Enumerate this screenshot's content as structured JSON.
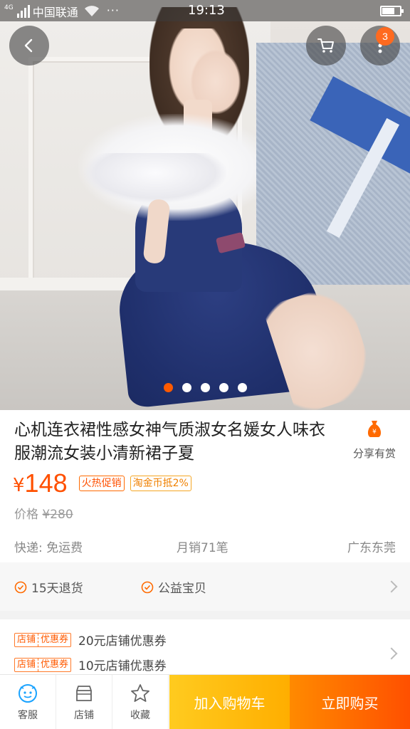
{
  "status_bar": {
    "network": "4G",
    "carrier": "中国联通",
    "dots": "···",
    "time": "19:13",
    "battery_level": 0.7
  },
  "hero": {
    "image_description": "model in navy dress with white ruffled collar",
    "cart_badge": "3",
    "carousel": {
      "count": 5,
      "active_index": 0
    },
    "colors": {
      "active_dot": "#ff5a00",
      "dress": "#283a79"
    }
  },
  "product": {
    "title": "心机连衣裙性感女神气质淑女名媛女人味衣服潮流女装小清新裙子夏",
    "share_label": "分享有赏",
    "price_symbol": "¥",
    "price": "148",
    "tags": [
      "火热促销",
      "淘金币抵2%"
    ],
    "original_price_label": "价格",
    "original_price": "¥280",
    "shipping": "快递: 免运费",
    "monthly_sales": "月销71笔",
    "location": "广东东莞"
  },
  "services": [
    {
      "label": "15天退货",
      "icon": "check-circle-icon"
    },
    {
      "label": "公益宝贝",
      "icon": "check-circle-icon"
    }
  ],
  "coupons": [
    {
      "tag_left": "店铺",
      "tag_right": "优惠券",
      "text": "20元店铺优惠券"
    },
    {
      "tag_left": "店铺",
      "tag_right": "优惠券",
      "text": "10元店铺优惠券"
    }
  ],
  "bottom_bar": {
    "customer_service": "客服",
    "shop": "店铺",
    "favorite": "收藏",
    "add_to_cart": "加入购物车",
    "buy_now": "立即购买"
  },
  "theme": {
    "accent": "#ff5000",
    "gold": "#ffb300"
  }
}
